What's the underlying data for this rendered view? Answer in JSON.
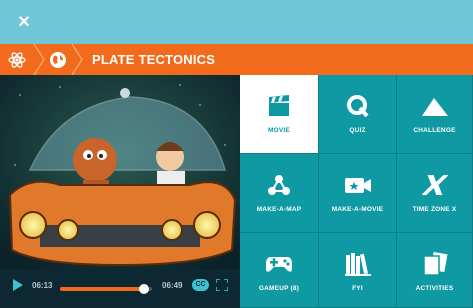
{
  "topbar": {
    "close_glyph": "×",
    "close_icon": "close-icon"
  },
  "breadcrumb": {
    "items": [
      {
        "icon": "atom-icon"
      },
      {
        "icon": "globe-icon"
      }
    ],
    "title": "PLATE TECTONICS"
  },
  "player": {
    "elapsed": "06:13",
    "duration": "06:49",
    "progress": 0.91,
    "cc_label": "CC",
    "play_icon": "play-icon",
    "fullscreen_icon": "fullscreen-icon"
  },
  "tiles": [
    {
      "label": "MOVIE",
      "icon": "clapperboard-icon",
      "active": true
    },
    {
      "label": "QUIZ",
      "icon": "quiz-q-icon",
      "active": false
    },
    {
      "label": "CHALLENGE",
      "icon": "mountain-icon",
      "active": false
    },
    {
      "label": "MAKE-A-MAP",
      "icon": "nodes-icon",
      "active": false
    },
    {
      "label": "MAKE-A-MOVIE",
      "icon": "video-camera-icon",
      "active": false
    },
    {
      "label": "TIME ZONE X",
      "icon": "time-zone-x-icon",
      "active": false
    },
    {
      "label": "GAMEUP (8)",
      "icon": "gamepad-icon",
      "active": false
    },
    {
      "label": "FYI",
      "icon": "books-icon",
      "active": false
    },
    {
      "label": "ACTIVITIES",
      "icon": "cards-icon",
      "active": false
    }
  ],
  "colors": {
    "topbar": "#6ec6d6",
    "crumbbar": "#f26b1d",
    "tile": "#0f9aa3",
    "tile_active": "#ffffff",
    "progress": "#f26b1d"
  }
}
